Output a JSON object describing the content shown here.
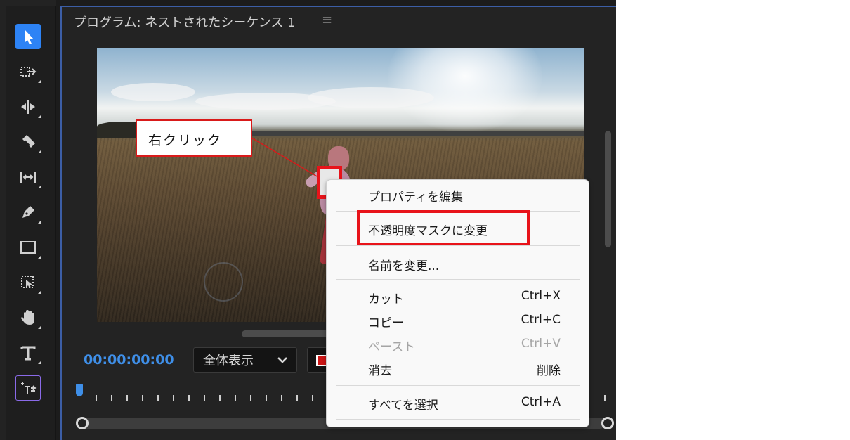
{
  "panel": {
    "title": "プログラム: ネストされたシーケンス 1",
    "menu_icon": "≡"
  },
  "tools": [
    {
      "name": "selection-tool",
      "icon": "arrow-icon",
      "active": true
    },
    {
      "name": "track-select-tool",
      "icon": "track-select-forward-icon"
    },
    {
      "name": "ripple-edit-tool",
      "icon": "ripple-edit-icon"
    },
    {
      "name": "razor-tool",
      "icon": "razor-icon"
    },
    {
      "name": "slip-tool",
      "icon": "slip-icon"
    },
    {
      "name": "pen-tool",
      "icon": "pen-icon"
    },
    {
      "name": "rectangle-tool",
      "icon": "rectangle-icon"
    },
    {
      "name": "track-matte-tool",
      "icon": "track-matte-icon"
    },
    {
      "name": "hand-tool",
      "icon": "hand-icon"
    },
    {
      "name": "type-tool",
      "icon": "type-icon"
    },
    {
      "name": "generative-extend-tool",
      "icon": "generative-extend-icon"
    }
  ],
  "timecode": "00:00:00:00",
  "zoom": {
    "value": "全体表示",
    "icon": "chevron-down-icon"
  },
  "quality": {
    "icon": "record-icon"
  },
  "annotation": {
    "callout": "右クリック",
    "highlight_color": "#e8131a"
  },
  "context_menu": {
    "items": [
      {
        "label": "プロパティを編集",
        "shortcut": "",
        "enabled": true
      },
      {
        "label": "不透明度マスクに変更",
        "shortcut": "",
        "enabled": true,
        "highlighted": true
      },
      {
        "label": "名前を変更...",
        "shortcut": "",
        "enabled": true
      },
      {
        "label": "カット",
        "shortcut": "Ctrl+X",
        "enabled": true
      },
      {
        "label": "コピー",
        "shortcut": "Ctrl+C",
        "enabled": true
      },
      {
        "label": "ペースト",
        "shortcut": "Ctrl+V",
        "enabled": false
      },
      {
        "label": "消去",
        "shortcut": "削除",
        "enabled": true
      },
      {
        "label": "すべてを選択",
        "shortcut": "Ctrl+A",
        "enabled": true
      }
    ]
  },
  "colors": {
    "accent_blue": "#2d83f5",
    "timecode_blue": "#3f8fe8",
    "panel_bg": "#232323"
  }
}
